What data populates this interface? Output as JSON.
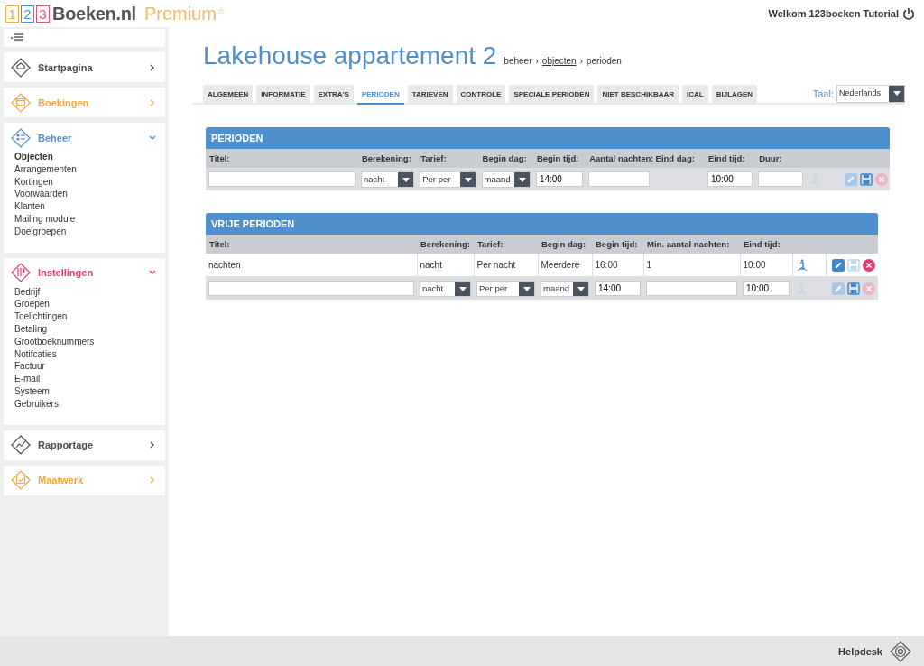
{
  "header": {
    "logo_digits": [
      {
        "text": "1",
        "color": "#e8a84c"
      },
      {
        "text": "2",
        "color": "#4f8fcc"
      },
      {
        "text": "3",
        "color": "#d9527f"
      }
    ],
    "logo_name": "Boeken.nl",
    "logo_tier": "Premium",
    "logo_star": "☆",
    "welcome": "Welkom 123boeken Tutorial"
  },
  "sidebar": {
    "sections": [
      {
        "label": "Startpagina",
        "color": "#4a4f57",
        "expanded": false
      },
      {
        "label": "Boekingen",
        "color": "#f0a83c",
        "expanded": false
      },
      {
        "label": "Beheer",
        "color": "#4f8fcc",
        "expanded": true,
        "items": [
          {
            "label": "Objecten",
            "selected": true
          },
          {
            "label": "Arrangementen",
            "selected": false
          },
          {
            "label": "Kortingen",
            "selected": false
          },
          {
            "label": "Voorwaarden",
            "selected": false
          },
          {
            "label": "Klanten",
            "selected": false
          },
          {
            "label": "Mailing module",
            "selected": false
          },
          {
            "label": "Doelgroepen",
            "selected": false
          }
        ]
      },
      {
        "label": "Instellingen",
        "color": "#de3f6f",
        "expanded": true,
        "items": [
          {
            "label": "Bedrijf",
            "selected": false
          },
          {
            "label": "Groepen",
            "selected": false
          },
          {
            "label": "Toelichtingen",
            "selected": false
          },
          {
            "label": "Betaling",
            "selected": false
          },
          {
            "label": "Grootboeknummers",
            "selected": false
          },
          {
            "label": "Notifcaties",
            "selected": false
          },
          {
            "label": "Factuur",
            "selected": false
          },
          {
            "label": "E-mail",
            "selected": false
          },
          {
            "label": "Systeem",
            "selected": false
          },
          {
            "label": "Gebruikers",
            "selected": false
          }
        ]
      },
      {
        "label": "Rapportage",
        "color": "#4a4f57",
        "expanded": false
      },
      {
        "label": "Maatwerk",
        "color": "#f0a83c",
        "expanded": false
      }
    ]
  },
  "page": {
    "title": "Lakehouse appartement 2",
    "breadcrumb": [
      {
        "label": "beheer",
        "link": false
      },
      {
        "label": "objecten",
        "link": true
      },
      {
        "label": "perioden",
        "link": false
      }
    ],
    "breadcrumb_separator": "›"
  },
  "tabs": [
    {
      "label": "ALGEMEEN",
      "selected": false
    },
    {
      "label": "INFORMATIE",
      "selected": false
    },
    {
      "label": "EXTRA'S",
      "selected": false
    },
    {
      "label": "PERIODEN",
      "selected": true
    },
    {
      "label": "TARIEVEN",
      "selected": false
    },
    {
      "label": "CONTROLE",
      "selected": false
    },
    {
      "label": "SPECIALE PERIODEN",
      "selected": false
    },
    {
      "label": "NIET BESCHIKBAAR",
      "selected": false
    },
    {
      "label": "ICAL",
      "selected": false
    },
    {
      "label": "BIJLAGEN",
      "selected": false
    }
  ],
  "language": {
    "label": "Taal:",
    "value": "Nederlands"
  },
  "panels": [
    {
      "title": "PERIODEN",
      "columns": [
        "Titel:",
        "Berekening:",
        "Tarief:",
        "Begin dag:",
        "Begin tijd:",
        "Aantal nachten:",
        "Eind dag:",
        "Eind tijd:",
        "Duur:"
      ],
      "rows": [
        {
          "kind": "edit",
          "cells": [
            {
              "kind": "input"
            },
            {
              "kind": "select",
              "value": "nacht"
            },
            {
              "kind": "select",
              "value": "Per per"
            },
            {
              "kind": "select",
              "value": "maand"
            },
            {
              "kind": "input",
              "value": "14:00"
            },
            {
              "kind": "input"
            },
            {
              "kind": "empty"
            },
            {
              "kind": "input",
              "value": "10:00"
            },
            {
              "kind": "input"
            }
          ],
          "actions": [
            {
              "kind": "info",
              "disabled": true
            },
            {
              "kind": "edit",
              "disabled": true
            },
            {
              "kind": "save",
              "disabled": false
            },
            {
              "kind": "delete",
              "disabled": true
            }
          ]
        }
      ]
    },
    {
      "title": "VRIJE PERIODEN",
      "columns": [
        "Titel:",
        "Berekening:",
        "Tarief:",
        "Begin dag:",
        "Begin tijd:",
        "Min. aantal nachten:",
        "Eind tijd:"
      ],
      "rows": [
        {
          "kind": "display",
          "cells": [
            {
              "kind": "text",
              "value": "nachten"
            },
            {
              "kind": "text",
              "value": "nacht"
            },
            {
              "kind": "text",
              "value": "Per nacht"
            },
            {
              "kind": "text",
              "value": "Meerdere"
            },
            {
              "kind": "text",
              "value": "16:00"
            },
            {
              "kind": "text",
              "value": "1"
            },
            {
              "kind": "text",
              "value": "10:00"
            }
          ],
          "actions": [
            {
              "kind": "info",
              "disabled": false
            },
            {
              "kind": "edit",
              "disabled": false
            },
            {
              "kind": "save",
              "disabled": true
            },
            {
              "kind": "delete",
              "disabled": false
            }
          ]
        },
        {
          "kind": "edit",
          "cells": [
            {
              "kind": "input"
            },
            {
              "kind": "select",
              "value": "nacht"
            },
            {
              "kind": "select",
              "value": "Per per"
            },
            {
              "kind": "select",
              "value": "maand"
            },
            {
              "kind": "input",
              "value": "14:00"
            },
            {
              "kind": "input"
            },
            {
              "kind": "input",
              "value": "10:00"
            }
          ],
          "actions": [
            {
              "kind": "info",
              "disabled": true
            },
            {
              "kind": "edit",
              "disabled": true
            },
            {
              "kind": "save",
              "disabled": false
            },
            {
              "kind": "delete",
              "disabled": true
            }
          ]
        }
      ]
    }
  ],
  "footer": {
    "helpdesk": "Helpdesk"
  }
}
